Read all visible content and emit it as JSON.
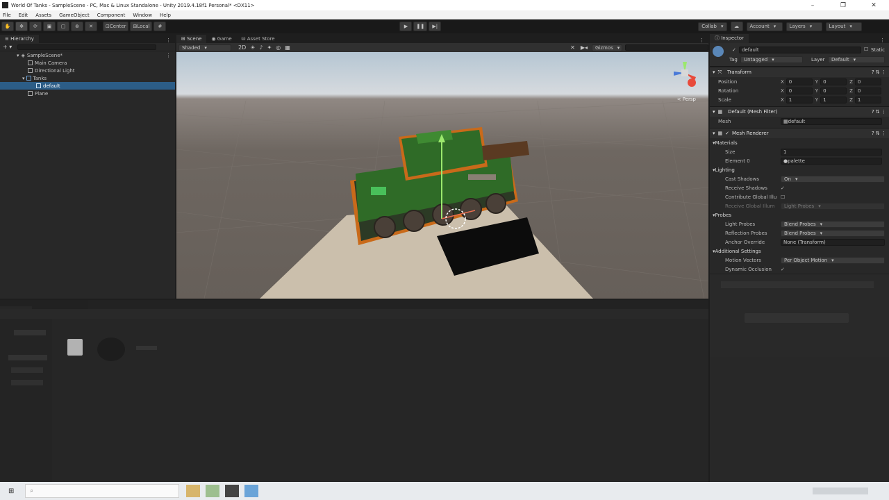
{
  "window": {
    "title": "World Of Tanks - SampleScene - PC, Mac & Linux Standalone - Unity 2019.4.18f1 Personal* <DX11>"
  },
  "menu": [
    "File",
    "Edit",
    "Assets",
    "GameObject",
    "Component",
    "Window",
    "Help"
  ],
  "toolbar": {
    "pivot": "Center",
    "space": "Local",
    "collab": "Collab",
    "account": "Account",
    "layers": "Layers",
    "layout": "Layout"
  },
  "hierarchy": {
    "tab": "Hierarchy",
    "scene": "SampleScene*",
    "items": [
      "Main Camera",
      "Directional Light",
      "Tanks",
      "default",
      "Plane"
    ]
  },
  "scene_view": {
    "tabs": [
      "Scene",
      "Game",
      "Asset Store"
    ],
    "shading": "Shaded",
    "gizmos": "Gizmos",
    "persp": "< Persp"
  },
  "inspector": {
    "tab": "Inspector",
    "object_name": "default",
    "static_label": "Static",
    "tag_label": "Tag",
    "tag_value": "Untagged",
    "layer_label": "Layer",
    "layer_value": "Default",
    "transform": {
      "title": "Transform",
      "rows": [
        {
          "label": "Position",
          "x": "0",
          "y": "0",
          "z": "0"
        },
        {
          "label": "Rotation",
          "x": "0",
          "y": "0",
          "z": "0"
        },
        {
          "label": "Scale",
          "x": "1",
          "y": "1",
          "z": "1"
        }
      ]
    },
    "mesh_filter": {
      "title": "Default (Mesh Filter)",
      "mesh_label": "Mesh",
      "mesh_value": "default"
    },
    "mesh_renderer": {
      "title": "Mesh Renderer",
      "materials_label": "Materials",
      "size_label": "Size",
      "size_value": "1",
      "element_label": "Element 0",
      "element_value": "palette",
      "lighting_label": "Lighting",
      "cast_shadows_label": "Cast Shadows",
      "cast_shadows_value": "On",
      "receive_shadows_label": "Receive Shadows",
      "contribute_gi_label": "Contribute Global Illu",
      "receive_gi_label": "Receive Global Illum",
      "receive_gi_value": "Light Probes",
      "probes_label": "Probes",
      "light_probes_label": "Light Probes",
      "light_probes_value": "Blend Probes",
      "reflection_probes_label": "Reflection Probes",
      "reflection_probes_value": "Blend Probes",
      "anchor_override_label": "Anchor Override",
      "anchor_override_value": "None (Transform)",
      "additional_label": "Additional Settings",
      "motion_vectors_label": "Motion Vectors",
      "motion_vectors_value": "Per Object Motion",
      "dynamic_occlusion_label": "Dynamic Occlusion"
    }
  },
  "colors": {
    "selection": "#2c5d87",
    "panel": "#282828",
    "tank_green": "#2f6b27",
    "tank_orange": "#c96a1a",
    "plane": "#cbbfac"
  }
}
